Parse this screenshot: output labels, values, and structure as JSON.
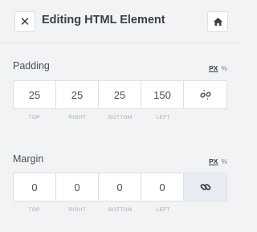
{
  "header": {
    "close_icon": "close-icon",
    "title": "Editing HTML Element",
    "home_icon": "home-icon"
  },
  "padding": {
    "label": "Padding",
    "unit_px": "PX",
    "unit_percent": "%",
    "values": [
      "25",
      "25",
      "25",
      "150"
    ],
    "sublabels": [
      "TOP",
      "RIGHT",
      "BOTTOM",
      "LEFT"
    ],
    "link_icon": "unlinked-icon"
  },
  "margin": {
    "label": "Margin",
    "unit_px": "PX",
    "unit_percent": "%",
    "values": [
      "0",
      "0",
      "0",
      "0"
    ],
    "sublabels": [
      "TOP",
      "RIGHT",
      "BOTTOM",
      "LEFT"
    ],
    "link_icon": "link-icon"
  }
}
